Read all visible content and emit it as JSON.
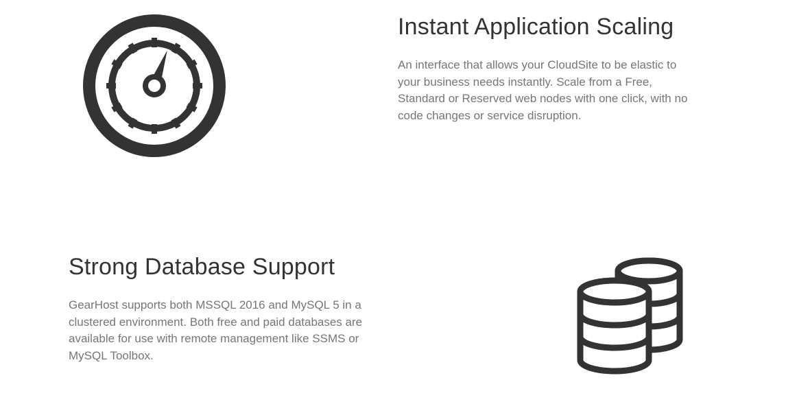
{
  "features": [
    {
      "title": "Instant Application Scaling",
      "description": "An interface that allows your CloudSite to be elastic to your business needs instantly. Scale from a Free, Standard or Reserved web nodes with one click, with no code changes or service disruption.",
      "icon": "gauge-icon"
    },
    {
      "title": "Strong Database Support",
      "description": "GearHost supports both MSSQL 2016 and MySQL 5 in a clustered environment. Both free and paid databases are available for use with remote management like SSMS or MySQL Toolbox.",
      "icon": "database-icon"
    }
  ]
}
